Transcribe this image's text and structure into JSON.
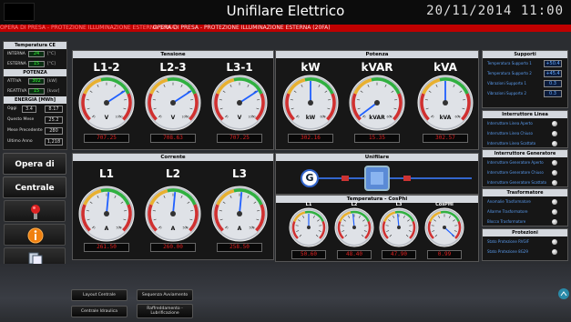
{
  "header": {
    "title": "Unifilare Elettrico",
    "datetime": "20/11/2014 11:00"
  },
  "alarm": {
    "text1": "OPERA DI PRESA - PROTEZIONE ILLUMINAZIONE ESTERNA (20FA)",
    "text2": "OPERA DI PRESA - PROTEZIONE ILLUMINAZIONE ESTERNA (20FA)"
  },
  "temp_panel": {
    "title": "Temperatura CE",
    "rows": [
      {
        "label": "INTERNA",
        "value": "24",
        "unit": "[°C]"
      },
      {
        "label": "ESTERNA",
        "value": "15",
        "unit": "[°C]"
      }
    ]
  },
  "power_panel": {
    "title": "POTENZA",
    "rows": [
      {
        "label": "ATTIVA",
        "value": "302",
        "unit": "[kW]"
      },
      {
        "label": "REATTIVA",
        "value": "15",
        "unit": "[kvar]"
      }
    ]
  },
  "energy_panel": {
    "title": "ENERGIA [MWh]",
    "rows": [
      {
        "label": "Oggi",
        "sel": "3.4",
        "value": "8.17"
      },
      {
        "label": "Questo Mese",
        "value": "25.2"
      },
      {
        "label": "Mese Precedente",
        "value": "280"
      },
      {
        "label": "Ultimo Anno",
        "value": "1,218"
      }
    ]
  },
  "nav": {
    "opera": "Opera di Presa",
    "centrale": "Centrale"
  },
  "icons": [
    "valve-icon",
    "info-icon",
    "copy-icon",
    "chart-icon",
    "users-icon"
  ],
  "sections": {
    "tensione": "Tensione",
    "potenza": "Potenza",
    "corrente": "Corrente",
    "unifilare": "Unifilare",
    "temperatura": "Temperatura - CosPhi"
  },
  "tensione": [
    {
      "label": "L1-2",
      "unit": "V",
      "value": "707.25",
      "min": "0",
      "max": "1000",
      "level": 0.71
    },
    {
      "label": "L2-3",
      "unit": "V",
      "value": "708.63",
      "min": "0",
      "max": "1000",
      "level": 0.71
    },
    {
      "label": "L3-1",
      "unit": "V",
      "value": "707.25",
      "min": "0",
      "max": "1000",
      "level": 0.71
    }
  ],
  "potenza": [
    {
      "label": "kW",
      "unit": "kW",
      "value": "302.16",
      "min": "0",
      "max": "600",
      "level": 0.5
    },
    {
      "label": "kVAR",
      "unit": "kVAR",
      "value": "15.35",
      "min": "0",
      "max": "600",
      "level": 0.03
    },
    {
      "label": "kVA",
      "unit": "kVA",
      "value": "302.57",
      "min": "0",
      "max": "600",
      "level": 0.5
    }
  ],
  "corrente": [
    {
      "label": "L1",
      "unit": "A",
      "value": "261.50",
      "min": "0",
      "max": "500",
      "level": 0.52
    },
    {
      "label": "L2",
      "unit": "A",
      "value": "260.00",
      "min": "0",
      "max": "500",
      "level": 0.52
    },
    {
      "label": "L3",
      "unit": "A",
      "value": "258.50",
      "min": "0",
      "max": "500",
      "level": 0.52
    }
  ],
  "small_gauges": [
    {
      "label": "L1",
      "value": "50.60",
      "level": 0.5
    },
    {
      "label": "L2",
      "value": "48.40",
      "level": 0.48
    },
    {
      "label": "L3",
      "value": "47.90",
      "level": 0.48
    },
    {
      "label": "CosPHI",
      "value": "0.99",
      "level": 0.99
    }
  ],
  "unifilare": {
    "generator": "G"
  },
  "supporti": {
    "title": "Supporti",
    "rows": [
      {
        "label": "Temperatura Supporto 1",
        "value": "+50.4"
      },
      {
        "label": "Temperatura Supporto 2",
        "value": "+45.4"
      },
      {
        "label": "Vibrazioni Supporto 1",
        "value": "0.3"
      },
      {
        "label": "Vibrazioni Supporto 2",
        "value": "0.3"
      }
    ]
  },
  "int_linea": {
    "title": "Interruttore Linea",
    "rows": [
      "Interruttore Linea Aperto",
      "Interruttore Linea Chiuso",
      "Interruttore Linea Scattato"
    ]
  },
  "int_gen": {
    "title": "Interruttore Generatore",
    "rows": [
      "Interruttore Generatore Aperto",
      "Interruttore Generatore Chiuso",
      "Interruttore Generatore Scattato"
    ]
  },
  "trasformatore": {
    "title": "Trasformatore",
    "rows": [
      "Anomalie Trasformatore",
      "Allarme Trasformatore",
      "Blocco Trasformatore"
    ]
  },
  "protezioni": {
    "title": "Protezioni",
    "rows": [
      "Stato Protezione RVGIF",
      "Stato Protezione 8G29"
    ]
  },
  "bottom": {
    "b1": "Layout Centrale",
    "b2": "Sequenza Avviamento",
    "b3": "Centrale Idraulica",
    "b4": "Raffreddamento - Lubrificazione"
  },
  "colors": {
    "alarm": "#c00000",
    "value_red": "#e02020",
    "value_green": "#33ff33",
    "needle": "#2060ff"
  }
}
